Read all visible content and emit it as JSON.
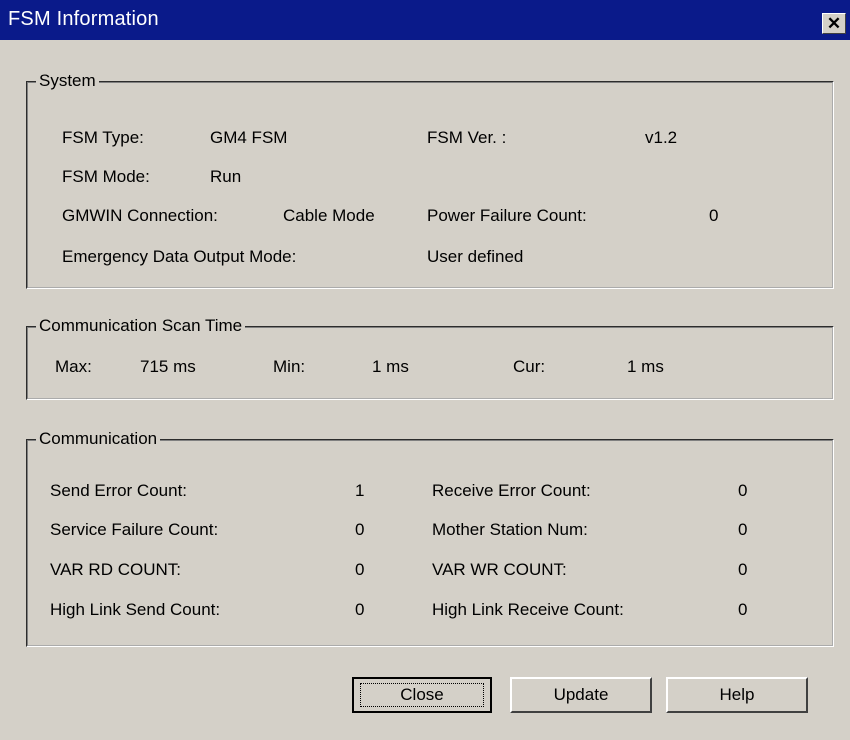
{
  "window": {
    "title": "FSM Information",
    "close_glyph": "✕"
  },
  "system": {
    "legend": "System",
    "fsm_type_label": "FSM Type:",
    "fsm_type_value": "GM4 FSM",
    "fsm_ver_label": "FSM Ver. :",
    "fsm_ver_value": "v1.2",
    "fsm_mode_label": "FSM Mode:",
    "fsm_mode_value": "Run",
    "gmwin_label": "GMWIN Connection:",
    "gmwin_value": "Cable Mode",
    "power_label": "Power Failure Count:",
    "power_value": "0",
    "emergency_label": "Emergency Data Output Mode:",
    "emergency_value": "User defined"
  },
  "scan_time": {
    "legend": "Communication Scan Time",
    "max_label": "Max:",
    "max_value": "715 ms",
    "min_label": "Min:",
    "min_value": "1 ms",
    "cur_label": "Cur:",
    "cur_value": "1 ms"
  },
  "communication": {
    "legend": "Communication",
    "send_error_label": "Send Error Count:",
    "send_error_value": "1",
    "receive_error_label": "Receive Error Count:",
    "receive_error_value": "0",
    "service_failure_label": "Service Failure Count:",
    "service_failure_value": "0",
    "mother_station_label": "Mother Station Num:",
    "mother_station_value": "0",
    "var_rd_label": "VAR RD COUNT:",
    "var_rd_value": "0",
    "var_wr_label": "VAR WR COUNT:",
    "var_wr_value": "0",
    "hl_send_label": "High Link Send Count:",
    "hl_send_value": "0",
    "hl_receive_label": "High Link Receive Count:",
    "hl_receive_value": "0"
  },
  "buttons": {
    "close": "Close",
    "update": "Update",
    "help": "Help"
  }
}
